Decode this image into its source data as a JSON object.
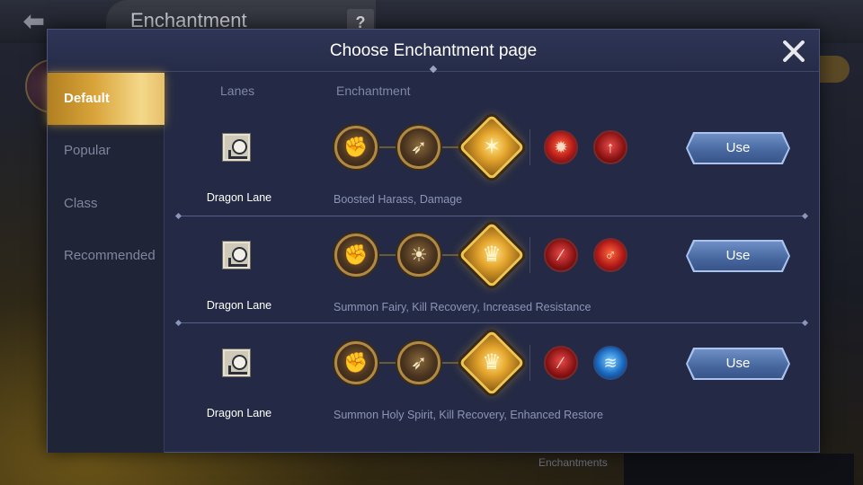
{
  "background": {
    "title": "Enchantment",
    "help_icon": "?",
    "back_icon": "back-arrow",
    "bottom_label": "Enchantments"
  },
  "modal": {
    "title": "Choose Enchantment page",
    "close_icon": "close-x"
  },
  "sidebar": {
    "items": [
      {
        "label": "Default",
        "active": true
      },
      {
        "label": "Popular",
        "active": false
      },
      {
        "label": "Class",
        "active": false
      },
      {
        "label": "Recommended",
        "active": false
      }
    ]
  },
  "columns": {
    "lanes": "Lanes",
    "enchantment": "Enchantment"
  },
  "pages": [
    {
      "lane": "Dragon Lane",
      "description": "Boosted Harass, Damage",
      "enchantments": [
        "gauntlet-icon",
        "arrow-emblem-icon",
        "golden-flame-icon"
      ],
      "runes": [
        "fire-rune-icon",
        "spear-rune-icon"
      ],
      "use_label": "Use"
    },
    {
      "lane": "Dragon Lane",
      "description": "Summon Fairy, Kill Recovery, Increased Resistance",
      "enchantments": [
        "gauntlet-icon",
        "open-book-icon",
        "golden-crest-icon"
      ],
      "runes": [
        "slash-rune-icon",
        "warrior-rune-icon"
      ],
      "use_label": "Use"
    },
    {
      "lane": "Dragon Lane",
      "description": "Summon Holy Spirit, Kill Recovery, Enhanced Restore",
      "enchantments": [
        "gauntlet-icon",
        "arrow-emblem-icon",
        "golden-crest-icon"
      ],
      "runes": [
        "slash-rune-icon",
        "water-rune-icon"
      ],
      "use_label": "Use"
    }
  ],
  "colors": {
    "accent_gold": "#d9a43a",
    "use_button": "#46669f",
    "modal_bg": "#242a45"
  }
}
